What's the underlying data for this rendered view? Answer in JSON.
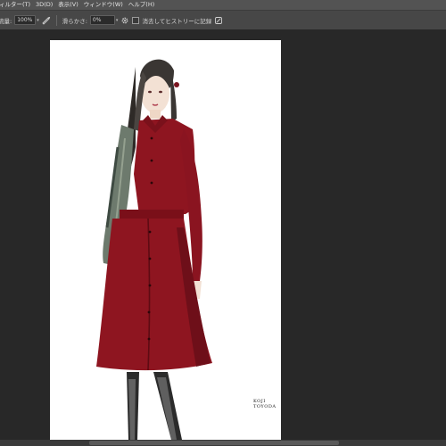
{
  "menu": {
    "items": [
      "ィルター(T)",
      "3D(D)",
      "表示(V)",
      "ウィンドウ(W)",
      "ヘルプ(H)"
    ]
  },
  "options": {
    "flow_label": "流量:",
    "flow_value": "100%",
    "smoothing_label": "滑らかさ:",
    "smoothing_value": "0%",
    "history_label": "消去してヒストリーに記録"
  },
  "document": {
    "signature": "KOJI TOYODA"
  },
  "colors": {
    "coat": "#8e1520",
    "coat_shadow": "#5e0b13",
    "hair": "#3a3633",
    "skin": "#f3e1d4"
  }
}
